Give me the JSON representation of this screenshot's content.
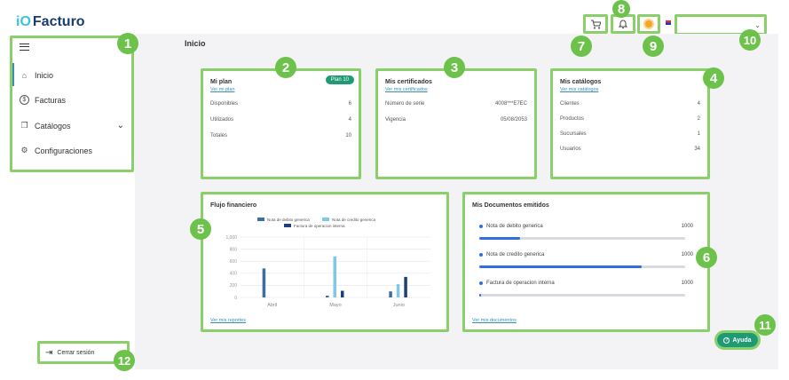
{
  "app": {
    "logo_mark": "iO",
    "logo_text": "Facturo"
  },
  "header": {
    "user_value": ""
  },
  "sidebar": {
    "menu_icon": "hamburger-icon",
    "items": [
      {
        "label": "Inicio",
        "icon": "home-icon"
      },
      {
        "label": "Facturas",
        "icon": "dollar-icon"
      },
      {
        "label": "Catálogos",
        "icon": "catalog-icon"
      },
      {
        "label": "Configuraciones",
        "icon": "gear-icon"
      }
    ],
    "logout_label": "Cerrar sesión"
  },
  "main": {
    "title": "Inicio"
  },
  "plan": {
    "title": "Mi plan",
    "link": "Ver mi plan",
    "badge": "Plan 10",
    "rows": [
      {
        "label": "Disponibles",
        "value": "6"
      },
      {
        "label": "Utilizados",
        "value": "4"
      },
      {
        "label": "Totales",
        "value": "10"
      }
    ]
  },
  "certificados": {
    "title": "Mis certificados",
    "link": "Ver mis certificados",
    "rows": [
      {
        "label": "Número de serie",
        "value": "4008***E7EC"
      },
      {
        "label": "Vigencia",
        "value": "05/08/2053"
      }
    ]
  },
  "catalogos": {
    "title": "Mis catálogos",
    "link": "Ver mis catálogos",
    "rows": [
      {
        "label": "Clientes",
        "value": "4"
      },
      {
        "label": "Productos",
        "value": "2"
      },
      {
        "label": "Sucursales",
        "value": "1"
      },
      {
        "label": "Usuarios",
        "value": "34"
      }
    ]
  },
  "flujo": {
    "title": "Flujo financiero",
    "link": "Ver mis reportes"
  },
  "chart_data": {
    "type": "bar",
    "categories": [
      "Abril",
      "Mayo",
      "Junio"
    ],
    "series": [
      {
        "name": "Nota de debito generica",
        "color": "#3a6ea5",
        "values": [
          480,
          30,
          100
        ]
      },
      {
        "name": "Nota de credito generica",
        "color": "#7fc9e8",
        "values": [
          0,
          680,
          220
        ]
      },
      {
        "name": "Factura de operacion interna",
        "color": "#1f3f7a",
        "values": [
          0,
          110,
          340
        ]
      }
    ],
    "yticks": [
      "0",
      "200",
      "400",
      "600",
      "800",
      "1,000"
    ],
    "ylim": [
      0,
      1000
    ],
    "legend": "top"
  },
  "documentos": {
    "title": "Mis Documentos emitidos",
    "link": "Ver mis documentos",
    "items": [
      {
        "label": "Nota de debito generica",
        "value": "1000",
        "progress": 0.2
      },
      {
        "label": "Nota de credito generica",
        "value": "1000",
        "progress": 0.79
      },
      {
        "label": "Factura de operacion interna",
        "value": "1000",
        "progress": 0.01
      }
    ]
  },
  "help_label": "Ayuda",
  "badges": [
    "1",
    "2",
    "3",
    "4",
    "5",
    "6",
    "7",
    "8",
    "9",
    "10",
    "11",
    "12"
  ]
}
